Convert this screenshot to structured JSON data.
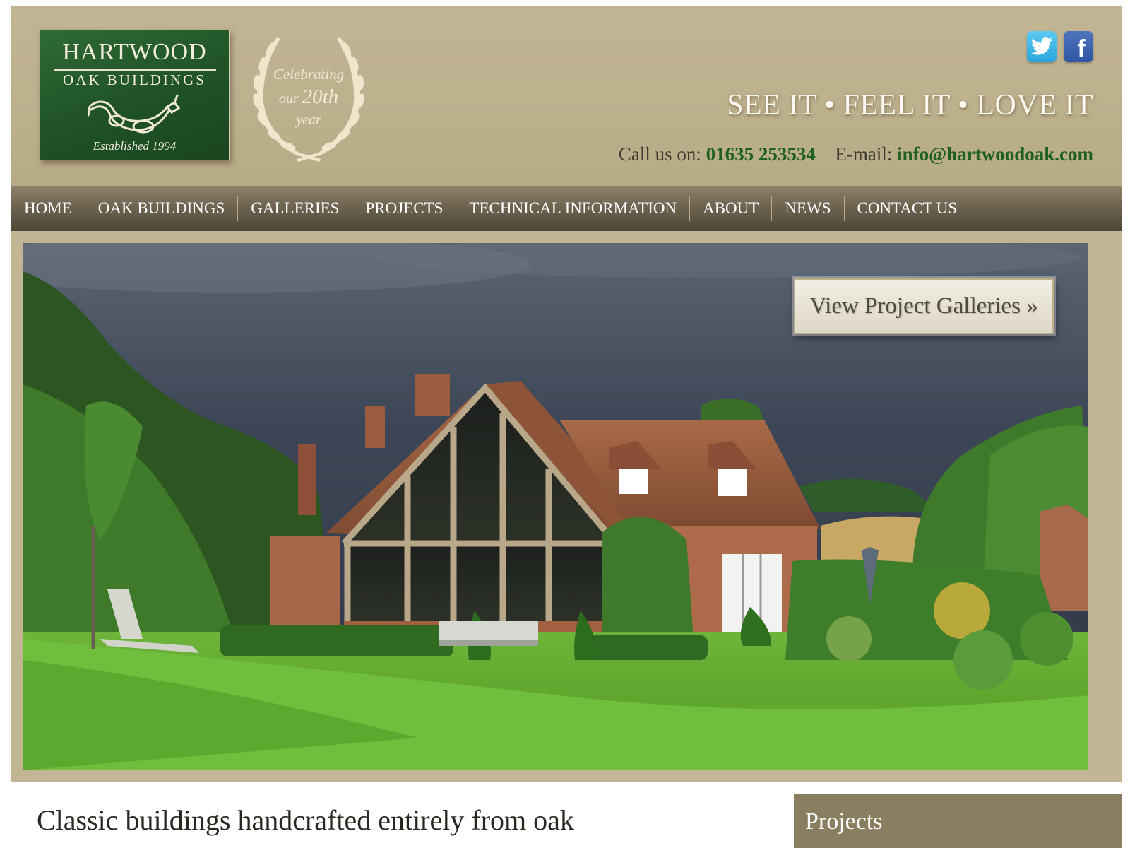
{
  "header": {
    "logo": {
      "line1": "HARTWOOD",
      "line2": "OAK BUILDINGS",
      "established": "Established 1994"
    },
    "anniversary": {
      "line1": "Celebrating",
      "line2_prefix": "our",
      "line2_big": "20th",
      "line3": "year"
    },
    "social": {
      "twitter_icon": "twitter-icon",
      "facebook_icon": "facebook-icon",
      "facebook_glyph": "f"
    },
    "tagline": "SEE IT • FEEL IT • LOVE IT",
    "contact": {
      "call_label": "Call us on:",
      "phone": "01635 253534",
      "email_label": "E-mail:",
      "email": "info@hartwoodoak.com"
    }
  },
  "nav": {
    "items": [
      {
        "label": "HOME"
      },
      {
        "label": "OAK BUILDINGS"
      },
      {
        "label": "GALLERIES"
      },
      {
        "label": "PROJECTS"
      },
      {
        "label": "TECHNICAL INFORMATION"
      },
      {
        "label": "ABOUT"
      },
      {
        "label": "NEWS"
      },
      {
        "label": "CONTACT US"
      }
    ]
  },
  "hero": {
    "button_label": "View Project Galleries »"
  },
  "content": {
    "headline": "Classic buildings handcrafted entirely from oak",
    "sidebar_title": "Projects"
  },
  "colors": {
    "header_bg": "#c2b594",
    "logo_green": "#1f5226",
    "nav_dark": "#4e4637",
    "link_green": "#1f5f22",
    "sidebar_bg": "#8a7e60"
  }
}
